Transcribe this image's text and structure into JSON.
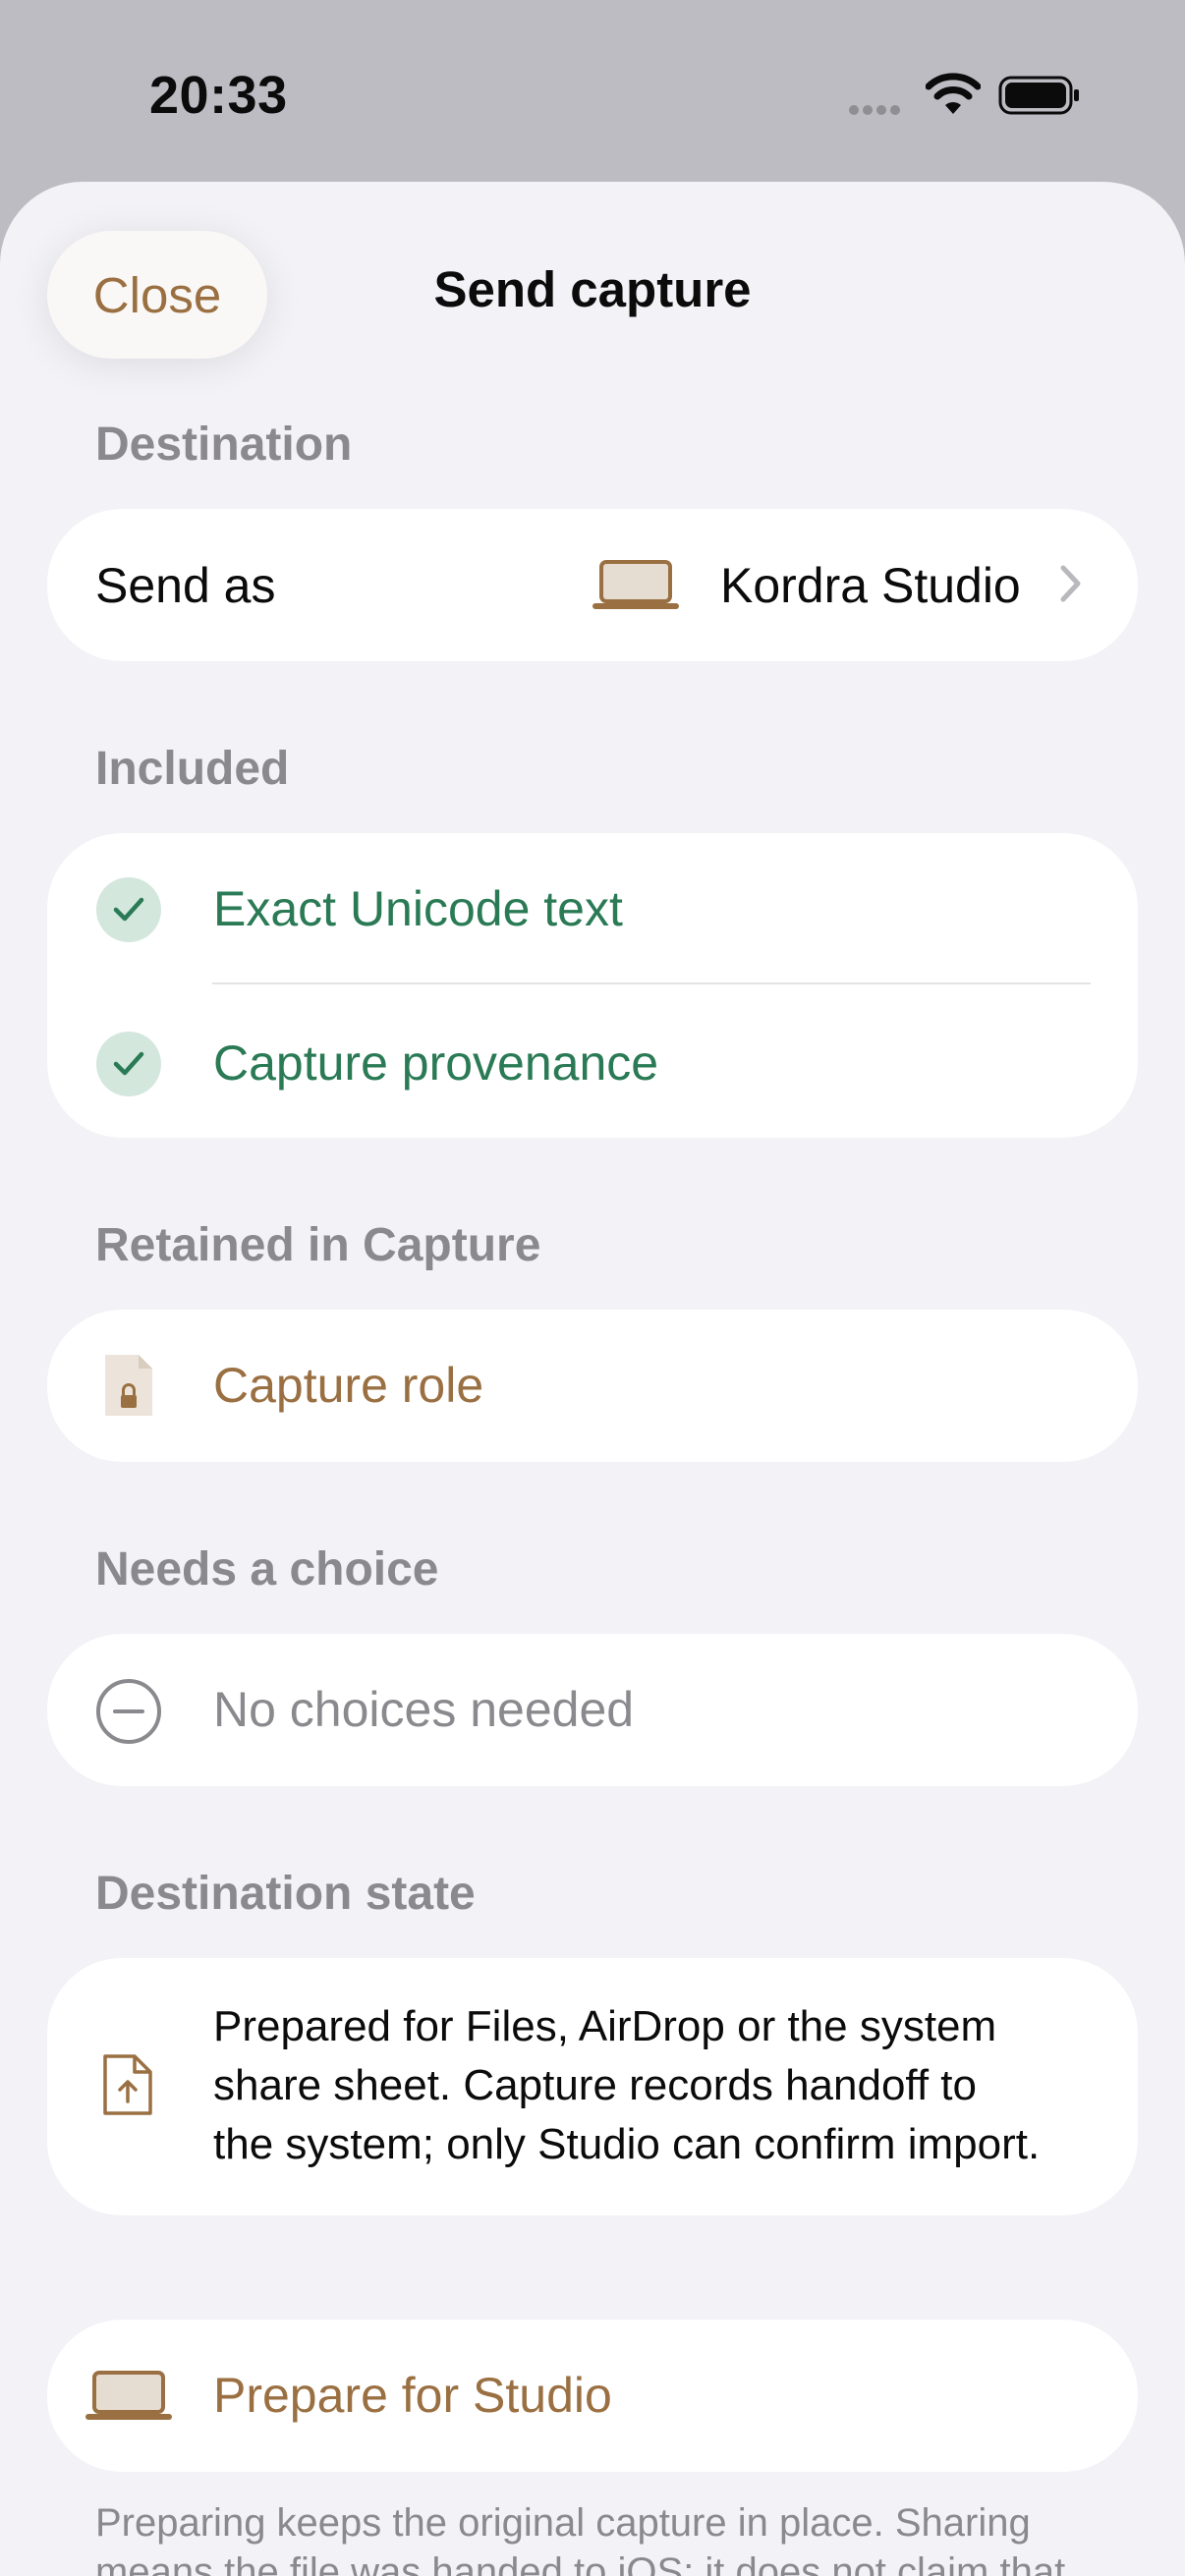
{
  "status_bar": {
    "time": "20:33"
  },
  "sheet": {
    "title": "Send capture",
    "close_label": "Close"
  },
  "destination": {
    "header": "Destination",
    "send_as_label": "Send as",
    "target_name": "Kordra Studio",
    "target_icon": "laptop-icon"
  },
  "included": {
    "header": "Included",
    "items": [
      {
        "label": "Exact Unicode text",
        "icon": "checkmark-icon"
      },
      {
        "label": "Capture provenance",
        "icon": "checkmark-icon"
      }
    ]
  },
  "retained": {
    "header": "Retained in Capture",
    "items": [
      {
        "label": "Capture role",
        "icon": "locked-document-icon"
      }
    ]
  },
  "needs_choice": {
    "header": "Needs a choice",
    "items": [
      {
        "label": "No choices needed",
        "icon": "minus-circle-icon"
      }
    ]
  },
  "destination_state": {
    "header": "Destination state",
    "lines": [
      "Prepared for Files, AirDrop or the system",
      "share sheet. Capture records handoff to",
      "the system; only Studio can confirm import."
    ],
    "icon": "document-upload-icon"
  },
  "prepare_button": {
    "label": "Prepare for Studio",
    "icon": "laptop-icon"
  },
  "footnote": {
    "lines": [
      "Preparing keeps the original capture in place. Sharing",
      "means the file was handed to iOS; it does not claim that"
    ]
  },
  "colors": {
    "accent_brown": "#9a7042",
    "success_green": "#2a7a55",
    "secondary_gray": "#8a8a8e",
    "sheet_background": "#f2f2f7"
  }
}
